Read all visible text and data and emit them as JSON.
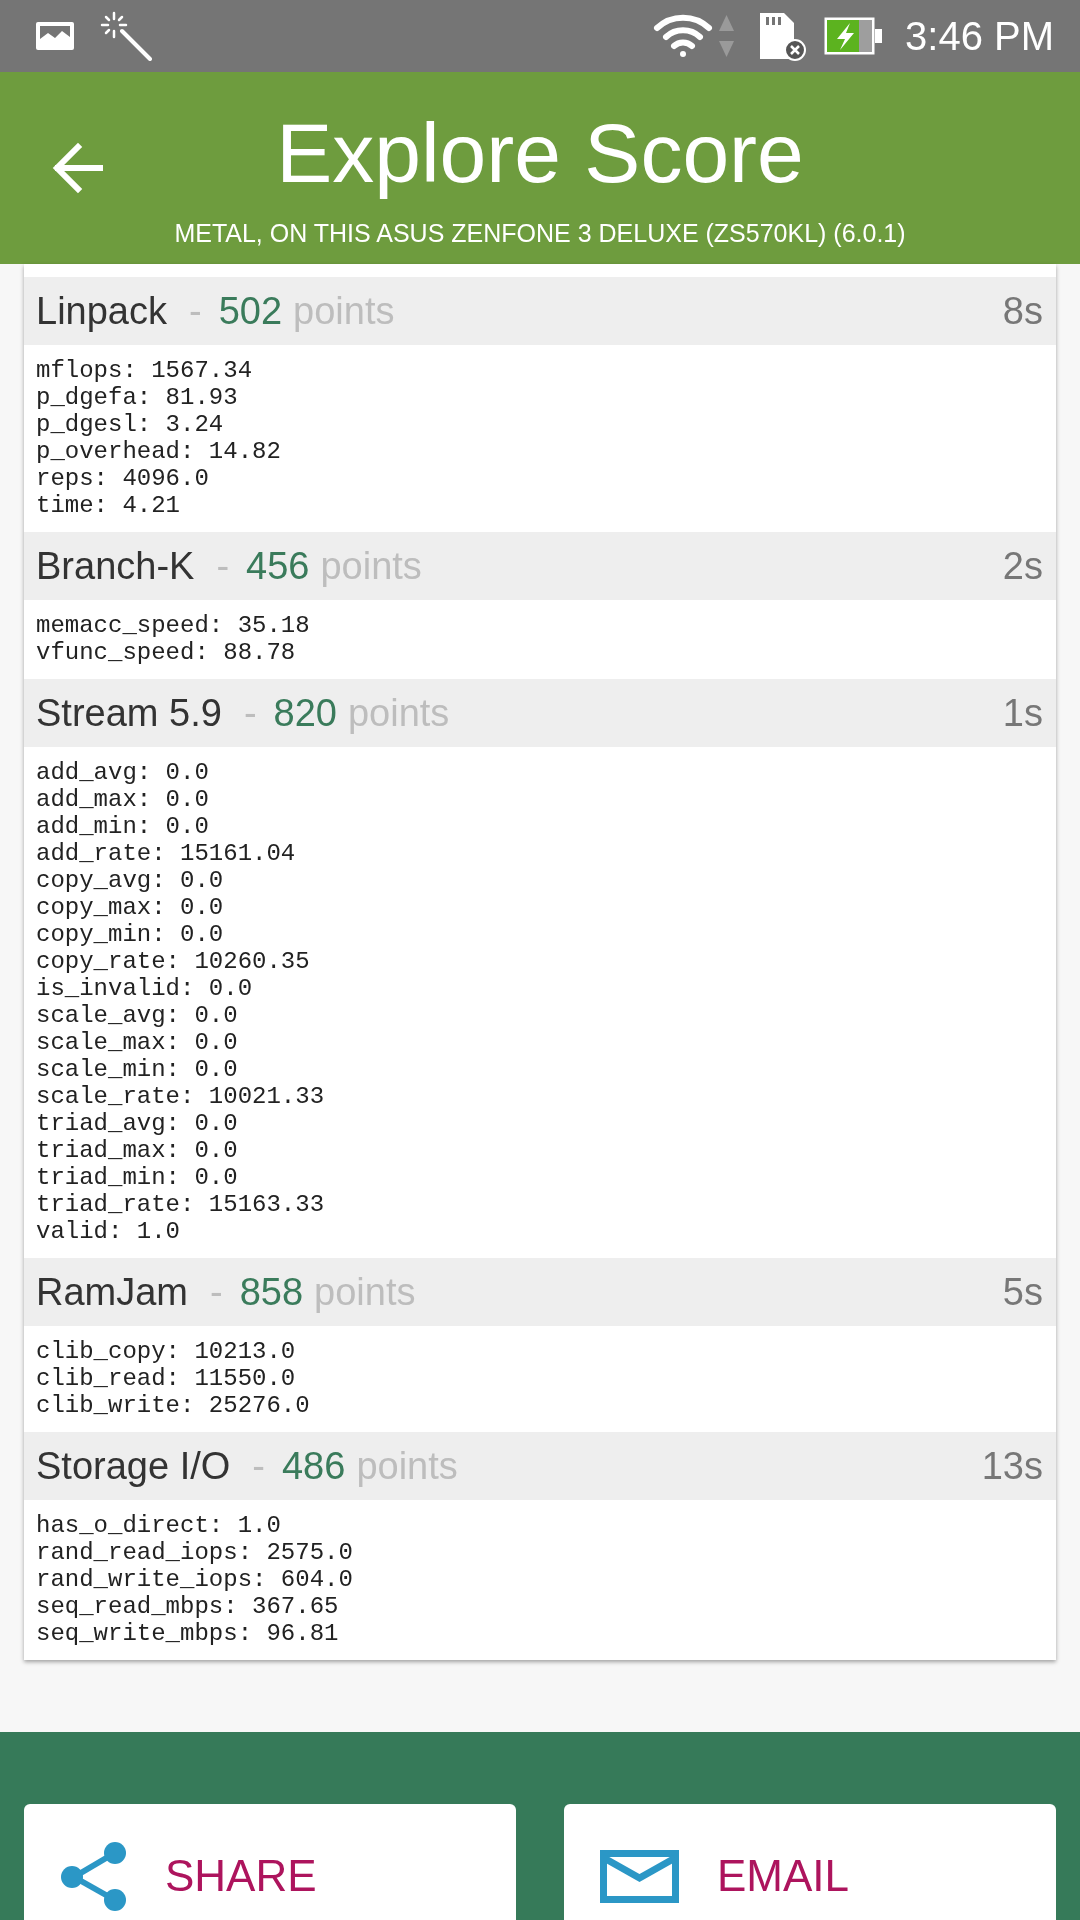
{
  "status_bar": {
    "time": "3:46 PM"
  },
  "header": {
    "title": "Explore Score",
    "subtitle": "METAL, ON THIS ASUS ZENFONE 3 DELUXE (ZS570KL) (6.0.1)"
  },
  "sections": [
    {
      "name": "Linpack",
      "separator": "-",
      "score": "502",
      "unit": "points",
      "duration": "8s",
      "metrics": [
        "mflops: 1567.34",
        "p_dgefa: 81.93",
        "p_dgesl: 3.24",
        "p_overhead: 14.82",
        "reps: 4096.0",
        "time: 4.21"
      ]
    },
    {
      "name": "Branch-K",
      "separator": "-",
      "score": "456",
      "unit": "points",
      "duration": "2s",
      "metrics": [
        "memacc_speed: 35.18",
        "vfunc_speed: 88.78"
      ]
    },
    {
      "name": "Stream 5.9",
      "separator": "-",
      "score": "820",
      "unit": "points",
      "duration": "1s",
      "metrics": [
        "add_avg: 0.0",
        "add_max: 0.0",
        "add_min: 0.0",
        "add_rate: 15161.04",
        "copy_avg: 0.0",
        "copy_max: 0.0",
        "copy_min: 0.0",
        "copy_rate: 10260.35",
        "is_invalid: 0.0",
        "scale_avg: 0.0",
        "scale_max: 0.0",
        "scale_min: 0.0",
        "scale_rate: 10021.33",
        "triad_avg: 0.0",
        "triad_max: 0.0",
        "triad_min: 0.0",
        "triad_rate: 15163.33",
        "valid: 1.0"
      ]
    },
    {
      "name": "RamJam",
      "separator": "-",
      "score": "858",
      "unit": "points",
      "duration": "5s",
      "metrics": [
        "clib_copy: 10213.0",
        "clib_read: 11550.0",
        "clib_write: 25276.0"
      ]
    },
    {
      "name": "Storage I/O",
      "separator": "-",
      "score": "486",
      "unit": "points",
      "duration": "13s",
      "metrics": [
        "has_o_direct: 1.0",
        "rand_read_iops: 2575.0",
        "rand_write_iops: 604.0",
        "seq_read_mbps: 367.65",
        "seq_write_mbps: 96.81"
      ]
    }
  ],
  "actions": [
    {
      "kind": "share",
      "label": "SHARE"
    },
    {
      "kind": "email",
      "label": "EMAIL"
    }
  ]
}
